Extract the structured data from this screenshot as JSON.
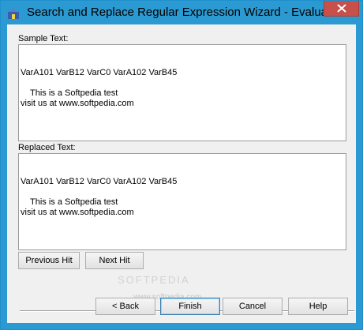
{
  "window": {
    "title": "Search and Replace Regular Expression Wizard - Evaluation"
  },
  "icons": {
    "app": "app-icon",
    "close": "close-icon"
  },
  "sample": {
    "label": "Sample Text:",
    "lines": [
      "VarA101 VarB12 VarC0 VarA102 VarB45",
      "",
      "    This is a Softpedia test",
      "visit us at www.softpedia.com"
    ]
  },
  "replaced": {
    "label": "Replaced Text:",
    "lines": [
      "VarA101 VarB12 VarC0 VarA102 VarB45",
      "",
      "    This is a Softpedia test",
      "visit us at www.softpedia.com"
    ]
  },
  "nav": {
    "previous_hit": "Previous Hit",
    "next_hit": "Next Hit"
  },
  "watermark": {
    "big": "SOFTPEDIA",
    "small": "www.softpedia.com"
  },
  "buttons": {
    "back": "< Back",
    "finish": "Finish",
    "cancel": "Cancel",
    "help": "Help"
  }
}
